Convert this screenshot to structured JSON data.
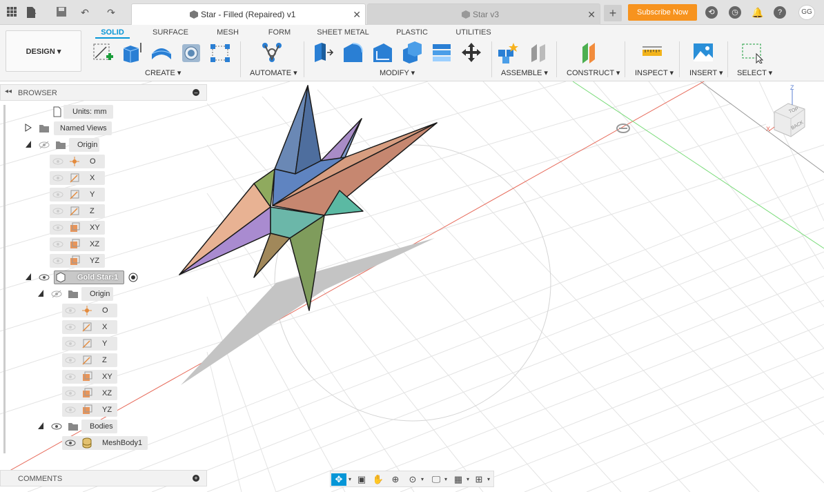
{
  "titlebar": {
    "tabs": [
      {
        "label": "Star - Filled (Repaired) v1",
        "active": true
      },
      {
        "label": "Star v3",
        "active": false
      }
    ],
    "subscribe_label": "Subscribe Now",
    "user_initials": "GG",
    "brand_color": "#f7931e"
  },
  "toolbar": {
    "design_label": "DESIGN ▾",
    "workspace_tabs": [
      "SOLID",
      "SURFACE",
      "MESH",
      "FORM",
      "SHEET METAL",
      "PLASTIC",
      "UTILITIES"
    ],
    "active_tab": "SOLID",
    "groups": [
      "CREATE ▾",
      "AUTOMATE ▾",
      "MODIFY ▾",
      "ASSEMBLE ▾",
      "CONSTRUCT ▾",
      "INSPECT ▾",
      "INSERT ▾",
      "SELECT ▾"
    ],
    "accent_color": "#0696d7"
  },
  "browser": {
    "title": "BROWSER",
    "units": "Units: mm",
    "named_views": "Named Views",
    "origin": "Origin",
    "origin_items": [
      "O",
      "X",
      "Y",
      "Z",
      "XY",
      "XZ",
      "YZ"
    ],
    "component": "Gold Star:1",
    "component_origin": "Origin",
    "component_origin_items": [
      "O",
      "X",
      "Y",
      "Z",
      "XY",
      "XZ",
      "YZ"
    ],
    "bodies": "Bodies",
    "body": "MeshBody1"
  },
  "comments": {
    "title": "COMMENTS"
  },
  "viewcube": {
    "top": "TOP",
    "back": "BACK",
    "axis_z": "Z",
    "axis_x": "X"
  }
}
